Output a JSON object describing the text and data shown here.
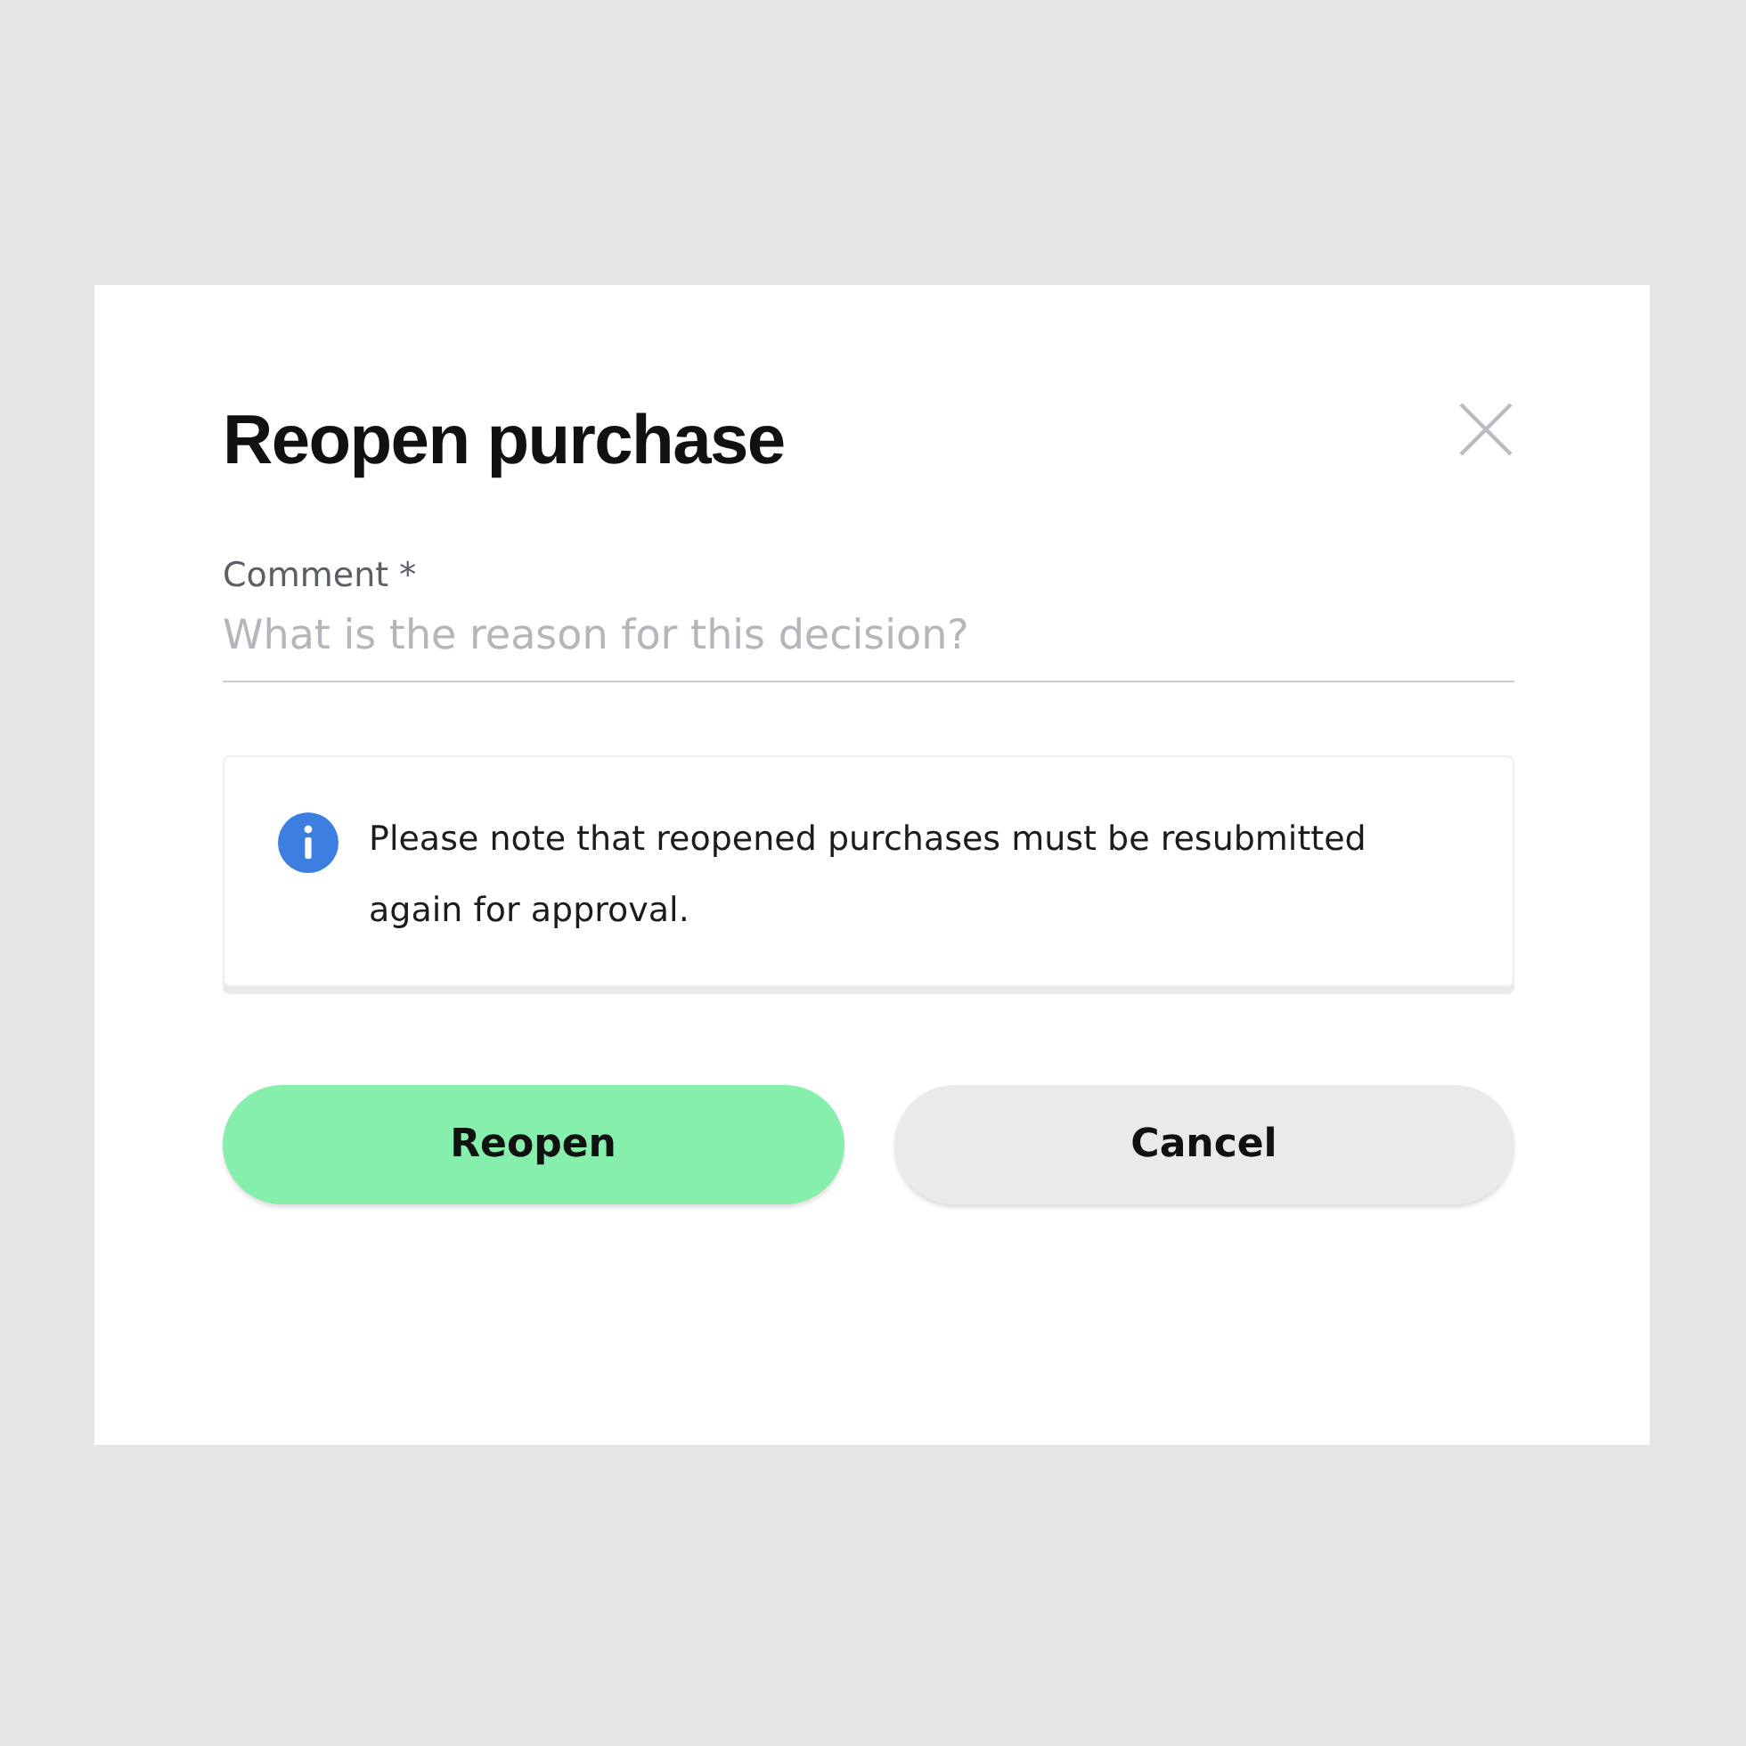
{
  "dialog": {
    "title": "Reopen purchase",
    "comment": {
      "label": "Comment *",
      "placeholder": "What is the reason for this decision?"
    },
    "notice": {
      "kind": "info",
      "text": "Please note that reopened purchases must be resubmitted again for approval."
    },
    "buttons": [
      {
        "label": "Reopen",
        "kind": "primary"
      },
      {
        "label": "Cancel",
        "kind": "secondary"
      }
    ]
  }
}
